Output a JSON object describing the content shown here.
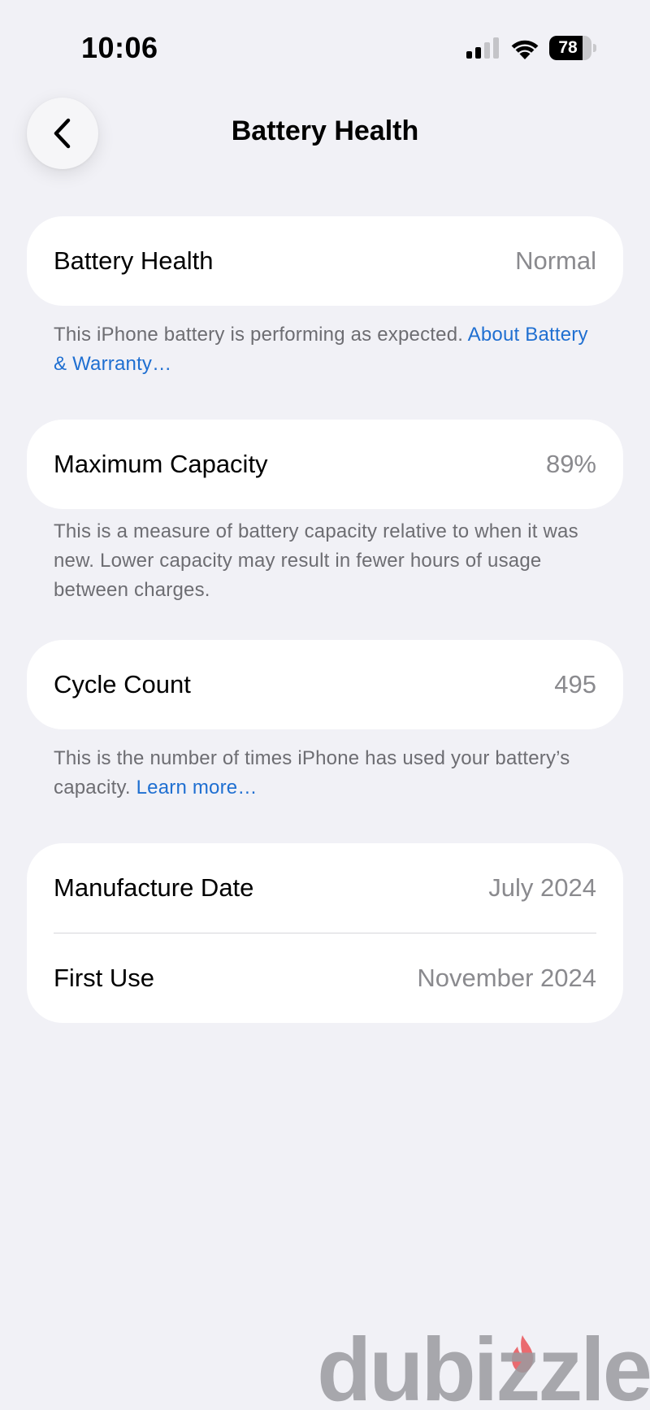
{
  "status_bar": {
    "time": "10:06",
    "battery_level": "78",
    "battery_fraction": 0.78
  },
  "nav": {
    "title": "Battery Health",
    "back_icon": "chevron-left-icon"
  },
  "battery_health": {
    "label": "Battery Health",
    "value": "Normal",
    "footnote_text": "This iPhone battery is performing as expected. ",
    "footnote_link": "About Battery & Warranty…"
  },
  "maximum_capacity": {
    "label": "Maximum Capacity",
    "value": "89%",
    "footnote_text": "This is a measure of battery capacity relative to when it was new. Lower capacity may result in fewer hours of usage between charges."
  },
  "cycle_count": {
    "label": "Cycle Count",
    "value": "495",
    "footnote_text": "This is the number of times iPhone has used your battery’s capacity. ",
    "footnote_link": "Learn more…"
  },
  "dates": {
    "manufacture_label": "Manufacture Date",
    "manufacture_value": "July 2024",
    "first_use_label": "First Use",
    "first_use_value": "November 2024"
  },
  "watermark": {
    "text": "dubizzle"
  },
  "colors": {
    "background": "#f1f1f6",
    "card": "#ffffff",
    "secondary_text": "#8a8a8e",
    "link": "#1f6fd1",
    "watermark_flame": "#e8484d"
  }
}
